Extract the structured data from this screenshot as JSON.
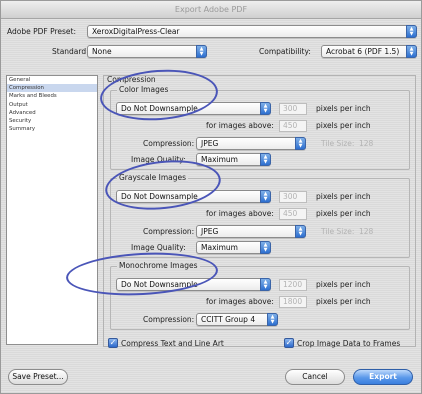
{
  "window": {
    "title": "Export Adobe PDF"
  },
  "preset": {
    "label": "Adobe PDF Preset:",
    "value": "XeroxDigitalPress-Clear"
  },
  "standard": {
    "label": "Standard:",
    "value": "None"
  },
  "compatibility": {
    "label": "Compatibility:",
    "value": "Acrobat 6 (PDF 1.5)"
  },
  "sidebar": {
    "items": [
      "General",
      "Compression",
      "Marks and Bleeds",
      "Output",
      "Advanced",
      "Security",
      "Summary"
    ],
    "selected_index": 1
  },
  "section": {
    "title": "Compression"
  },
  "color_images": {
    "title": "Color Images",
    "sampling": "Do Not Downsample",
    "ppi_value": "300",
    "ppi_unit": "pixels per inch",
    "above_label": "for images above:",
    "above_value": "450",
    "above_unit": "pixels per inch",
    "compression_label": "Compression:",
    "compression_value": "JPEG",
    "tile_label": "Tile Size:",
    "tile_value": "128",
    "quality_label": "Image Quality:",
    "quality_value": "Maximum"
  },
  "grayscale_images": {
    "title": "Grayscale Images",
    "sampling": "Do Not Downsample",
    "ppi_value": "300",
    "ppi_unit": "pixels per inch",
    "above_label": "for images above:",
    "above_value": "450",
    "above_unit": "pixels per inch",
    "compression_label": "Compression:",
    "compression_value": "JPEG",
    "tile_label": "Tile Size:",
    "tile_value": "128",
    "quality_label": "Image Quality:",
    "quality_value": "Maximum"
  },
  "monochrome_images": {
    "title": "Monochrome Images",
    "sampling": "Do Not Downsample",
    "ppi_value": "1200",
    "ppi_unit": "pixels per inch",
    "above_label": "for images above:",
    "above_value": "1800",
    "above_unit": "pixels per inch",
    "compression_label": "Compression:",
    "compression_value": "CCITT Group 4"
  },
  "options": {
    "compress_text": "Compress Text and Line Art",
    "crop_image": "Crop Image Data to Frames"
  },
  "buttons": {
    "save_preset": "Save Preset...",
    "cancel": "Cancel",
    "export": "Export"
  },
  "colors": {
    "accent": "#2d6fd0",
    "annotation": "#4a55b8",
    "sidebar_selected": "#c9d7ee"
  }
}
